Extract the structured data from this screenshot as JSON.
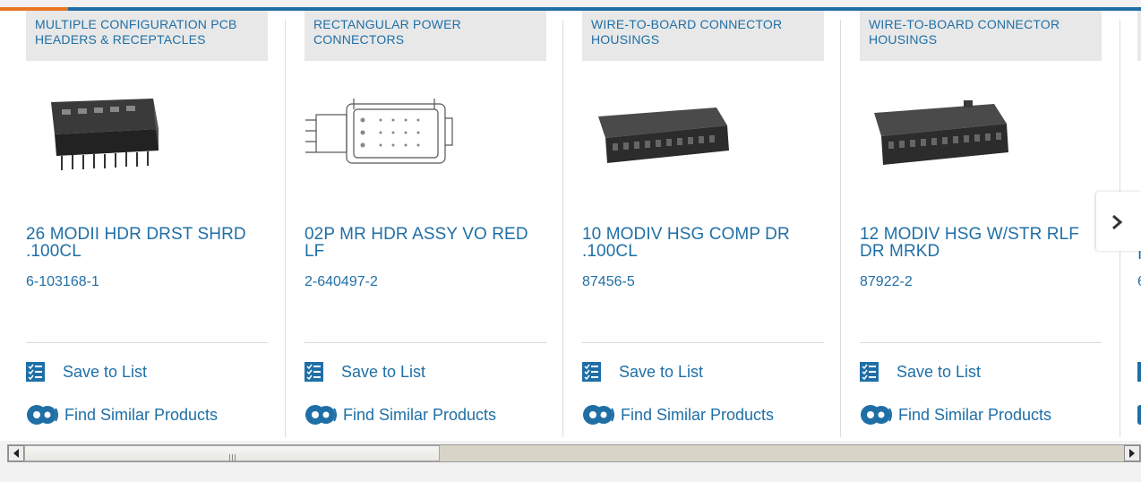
{
  "cards": [
    {
      "category": "MULTIPLE CONFIGURATION PCB HEADERS & RECEPTACLES",
      "title_line1": "26 MODII HDR DRST SHRD",
      "title_line2": ".100CL",
      "part_number": "6-103168-1",
      "save_label": "Save to List",
      "find_label": "Find Similar Products",
      "image_icon": "pcb-header-photo"
    },
    {
      "category": "RECTANGULAR POWER CONNECTORS",
      "title_line1": "02P MR HDR ASSY VO RED",
      "title_line2": "LF",
      "part_number": "2-640497-2",
      "save_label": "Save to List",
      "find_label": "Find Similar Products",
      "image_icon": "connector-drawing"
    },
    {
      "category": "WIRE-TO-BOARD CONNECTOR HOUSINGS",
      "title_line1": "10 MODIV HSG COMP DR",
      "title_line2": ".100CL",
      "part_number": "87456-5",
      "save_label": "Save to List",
      "find_label": "Find Similar Products",
      "image_icon": "housing-photo"
    },
    {
      "category": "WIRE-TO-BOARD CONNECTOR HOUSINGS",
      "title_line1": "12 MODIV HSG W/STR RLF",
      "title_line2": "DR MRKD",
      "part_number": "87922-2",
      "save_label": "Save to List",
      "find_label": "Find Similar Products",
      "image_icon": "housing-photo"
    }
  ],
  "partial_card": {
    "title_fragment": "I",
    "part_fragment": "6"
  },
  "icons": {
    "next": "chevron-right-icon",
    "save": "checklist-icon",
    "find": "gears-icon"
  },
  "colors": {
    "link": "#1f6fa6",
    "accent": "#e87722",
    "category_bg": "#e8e8e8"
  }
}
